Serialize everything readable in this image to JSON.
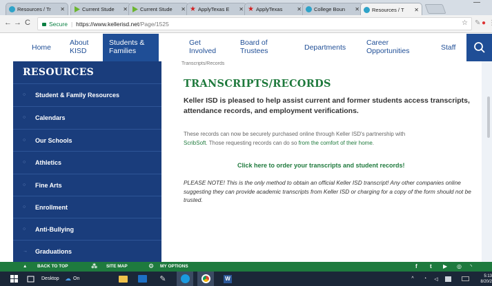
{
  "tabs": [
    {
      "label": "Resources / Tr",
      "icon": "resources-favicon",
      "active": false
    },
    {
      "label": "Current Stude",
      "icon": "play-favicon",
      "active": false
    },
    {
      "label": "Current Stude",
      "icon": "play-favicon",
      "active": false
    },
    {
      "label": "ApplyTexas E",
      "icon": "star-favicon",
      "active": false
    },
    {
      "label": "ApplyTexas",
      "icon": "star-favicon",
      "active": false
    },
    {
      "label": "College Boun",
      "icon": "collegeboard-favicon",
      "active": false
    },
    {
      "label": "Resources / T",
      "icon": "resources-favicon",
      "active": true
    }
  ],
  "address": {
    "secure_label": "Secure",
    "separator": "|",
    "url_host": "https://www.kellerisd.net",
    "url_path": "/Page/1525"
  },
  "nav": [
    {
      "label": "Home"
    },
    {
      "label": "About KISD"
    },
    {
      "label": "Students & Families"
    },
    {
      "label": "Get Involved"
    },
    {
      "label": "Board of Trustees"
    },
    {
      "label": "Departments"
    },
    {
      "label": "Career Opportunities"
    },
    {
      "label": "Staff"
    }
  ],
  "sidebar": {
    "title": "RESOURCES",
    "items": [
      {
        "label": "Student & Family Resources",
        "bullet": "○"
      },
      {
        "label": "Calendars",
        "bullet": "○"
      },
      {
        "label": "Our Schools",
        "bullet": "○"
      },
      {
        "label": "Athletics",
        "bullet": "○"
      },
      {
        "label": "Fine Arts",
        "bullet": "○"
      },
      {
        "label": "Enrollment",
        "bullet": "○"
      },
      {
        "label": "Anti-Bullying",
        "bullet": "○"
      },
      {
        "label": "Graduations",
        "bullet": "→"
      }
    ]
  },
  "content": {
    "breadcrumb": "Transcripts/Records",
    "heading": "TRANSCRIPTS/RECORDS",
    "intro": "Keller ISD is pleased to help assist current and former students access transcripts, attendance records, and employment verifications.",
    "body_part1": "These records can now be securely purchased online through Keller ISD's partnership with",
    "body_link1": "ScribSoft",
    "body_part2": ". Those requesting records can do so",
    "body_link2": "from the comfort of their home",
    "body_part3": ".",
    "order_link": "Click here to order your transcripts and student records!",
    "notice": "PLEASE NOTE! This is the only method to obtain an official Keller ISD transcript! Any other companies online suggesting they can provide academic transcripts from Keller ISD or charging for a copy of the form should not be trusted."
  },
  "bottom_bar": {
    "back_to_top": "BACK TO TOP",
    "site_map": "SITE MAP",
    "my_options": "MY OPTIONS"
  },
  "taskbar": {
    "desktop_label": "Desktop",
    "on_label": "On",
    "time": "5:13",
    "date": "8/20/2"
  },
  "colors": {
    "brand_blue": "#1f4e96",
    "sidebar_blue": "#1a3d7c",
    "brand_green": "#1f7a3d"
  }
}
